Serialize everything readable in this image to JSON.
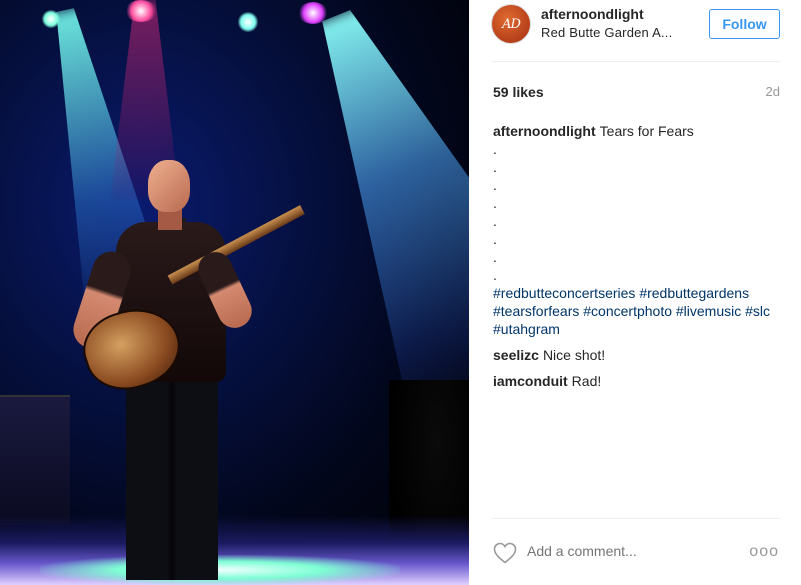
{
  "post": {
    "photo_description_icon": "concert-photo",
    "username": "afternoondlight",
    "avatar_initials": "AD",
    "location": "Red Butte Garden A...",
    "follow_label": "Follow",
    "likes": "59 likes",
    "age": "2d",
    "caption": {
      "user": "afternoondlight",
      "text": "Tears for Fears",
      "dots": [
        ".",
        ".",
        ".",
        ".",
        ".",
        ".",
        ".",
        "."
      ],
      "hashtags": [
        "#redbutteconcertseries",
        "#redbuttegardens",
        "#tearsforfears",
        "#concertphoto",
        "#livemusic",
        "#slc",
        "#utahgram"
      ]
    },
    "comments": [
      {
        "user": "seelizc",
        "text": "Nice shot!"
      },
      {
        "user": "iamconduit",
        "text": "Rad!"
      }
    ],
    "add_comment_placeholder": "Add a comment...",
    "more_label": "ooo",
    "accent_color": "#3897f0",
    "hashtag_color": "#003569"
  }
}
